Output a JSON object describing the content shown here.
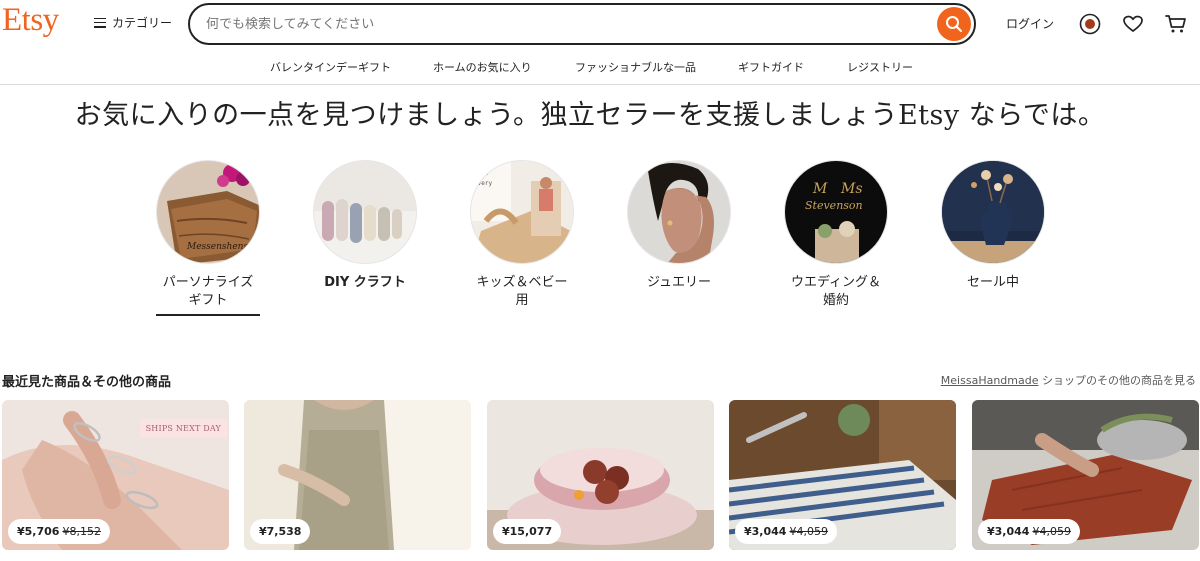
{
  "header": {
    "logo": "Etsy",
    "categories_label": "カテゴリー",
    "search_placeholder": "何でも検索してみてください",
    "login_label": "ログイン"
  },
  "nav": {
    "items": [
      "バレンタインデーギフト",
      "ホームのお気に入り",
      "ファッショナブルな一品",
      "ギフトガイド",
      "レジストリー"
    ]
  },
  "hero": {
    "title": "お気に入りの一点を見つけましょう。独立セラーを支援しましょうEtsy ならでは。"
  },
  "categories": [
    {
      "label": "パーソナライズ\nギフト",
      "selected": true
    },
    {
      "label": "DIY クラフト",
      "selected": false
    },
    {
      "label": "キッズ＆ベビー\n用",
      "selected": false
    },
    {
      "label": "ジュエリー",
      "selected": false
    },
    {
      "label": "ウエディング＆\n婚約",
      "selected": false
    },
    {
      "label": "セール中",
      "selected": false
    }
  ],
  "recent": {
    "title": "最近見た商品＆その他の商品",
    "shop_name": "MeissaHandmade",
    "shop_suffix": " ショップのその他の商品を見る"
  },
  "products": [
    {
      "price": "¥5,706",
      "original_price": "¥8,152",
      "badge": "SHIPS NEXT DAY"
    },
    {
      "price": "¥7,538",
      "original_price": ""
    },
    {
      "price": "¥15,077",
      "original_price": ""
    },
    {
      "price": "¥3,044",
      "original_price": "¥4,059"
    },
    {
      "price": "¥3,044",
      "original_price": "¥4,059"
    }
  ],
  "colors": {
    "brand": "#f1641e",
    "text": "#222222",
    "muted": "#595959"
  },
  "icons": [
    "menu-icon",
    "search-icon",
    "account-icon",
    "heart-icon",
    "cart-icon"
  ]
}
